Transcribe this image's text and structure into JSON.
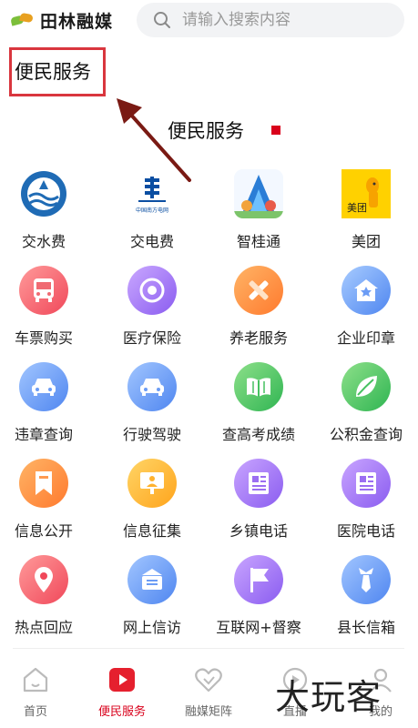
{
  "header": {
    "logo_text": "田林融媒",
    "search_placeholder": "请输入搜索内容"
  },
  "annotation": {
    "label": "便民服务"
  },
  "section": {
    "title": "便民服务"
  },
  "services": [
    [
      {
        "label": "交水费",
        "icon": "water-bureau-logo-icon"
      },
      {
        "label": "交电费",
        "icon": "china-southern-grid-logo-icon",
        "logo_text": "中国南方电网"
      },
      {
        "label": "智桂通",
        "icon": "zhiguitong-app-icon"
      },
      {
        "label": "美团",
        "icon": "meituan-app-icon",
        "logo_text": "美团"
      }
    ],
    [
      {
        "label": "车票购买",
        "icon": "bus-icon"
      },
      {
        "label": "医疗保险",
        "icon": "medical-insurance-icon"
      },
      {
        "label": "养老服务",
        "icon": "pencil-ruler-icon"
      },
      {
        "label": "企业印章",
        "icon": "seal-house-icon"
      }
    ],
    [
      {
        "label": "违章查询",
        "icon": "car-icon"
      },
      {
        "label": "行驶驾驶",
        "icon": "car-icon"
      },
      {
        "label": "查高考成绩",
        "icon": "open-book-icon"
      },
      {
        "label": "公积金查询",
        "icon": "leaf-icon"
      }
    ],
    [
      {
        "label": "信息公开",
        "icon": "bookmark-icon"
      },
      {
        "label": "信息征集",
        "icon": "presentation-board-icon"
      },
      {
        "label": "乡镇电话",
        "icon": "newspaper-icon"
      },
      {
        "label": "医院电话",
        "icon": "newspaper-icon"
      }
    ],
    [
      {
        "label": "热点回应",
        "icon": "location-pin-icon"
      },
      {
        "label": "网上信访",
        "icon": "mailbox-icon"
      },
      {
        "label": "互联网+督察",
        "icon": "flag-icon"
      },
      {
        "label": "县长信箱",
        "icon": "tie-icon"
      }
    ]
  ],
  "bottom_nav": [
    {
      "label": "首页",
      "icon": "home-icon",
      "active": false
    },
    {
      "label": "便民服务",
      "icon": "play-button-icon",
      "active": true
    },
    {
      "label": "融媒矩阵",
      "icon": "heart-icon",
      "active": false
    },
    {
      "label": "直播",
      "icon": "live-icon",
      "active": false
    },
    {
      "label": "我的",
      "icon": "profile-icon",
      "active": false
    }
  ],
  "watermark": "大玩客",
  "colors": {
    "accent": "#d9001b",
    "annotation": "#d9363e",
    "red_gradient": [
      "#ff8a8a",
      "#f0485a"
    ],
    "purple_gradient": [
      "#c9a5ff",
      "#8a5cf0"
    ],
    "orange_gradient": [
      "#ffb066",
      "#ff7a2e"
    ],
    "blue_gradient": [
      "#9fc4ff",
      "#4f86f0"
    ],
    "green_gradient": [
      "#8ee08a",
      "#2fb552"
    ]
  }
}
